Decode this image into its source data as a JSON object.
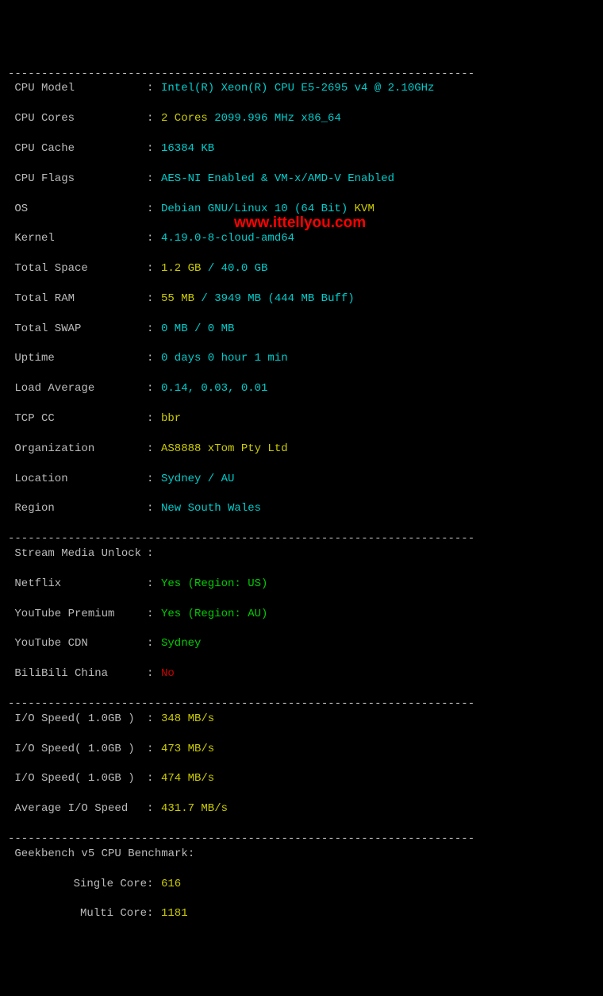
{
  "divider": "----------------------------------------------------------------------",
  "sys": {
    "cpu_model_label": " CPU Model",
    "cpu_model_value": "Intel(R) Xeon(R) CPU E5-2695 v4 @ 2.10GHz",
    "cpu_cores_label": " CPU Cores",
    "cpu_cores_count": "2 Cores",
    "cpu_cores_freq": "2099.996 MHz x86_64",
    "cpu_cache_label": " CPU Cache",
    "cpu_cache_value": "16384 KB",
    "cpu_flags_label": " CPU Flags",
    "cpu_flags_value": "AES-NI Enabled & VM-x/AMD-V Enabled",
    "os_label": " OS",
    "os_name": "Debian GNU/Linux 10 (64 Bit)",
    "os_virt": "KVM",
    "kernel_label": " Kernel",
    "kernel_value": "4.19.0-8-cloud-amd64",
    "total_space_label": " Total Space",
    "total_space_used": "1.2 GB",
    "total_space_sep": " / ",
    "total_space_total": "40.0 GB",
    "total_ram_label": " Total RAM",
    "total_ram_used": "55 MB",
    "total_ram_sep": " / ",
    "total_ram_total": "3949 MB",
    "total_ram_buff": "(444 MB Buff)",
    "total_swap_label": " Total SWAP",
    "total_swap_value": "0 MB / 0 MB",
    "uptime_label": " Uptime",
    "uptime_value": "0 days 0 hour 1 min",
    "load_label": " Load Average",
    "load_value": "0.14, 0.03, 0.01",
    "tcp_cc_label": " TCP CC",
    "tcp_cc_value": "bbr",
    "org_label": " Organization",
    "org_value": "AS8888 xTom Pty Ltd",
    "location_label": " Location",
    "location_value": "Sydney / AU",
    "region_label": " Region",
    "region_value": "New South Wales"
  },
  "stream": {
    "header_label": " Stream Media Unlock",
    "netflix_label": " Netflix",
    "netflix_value": "Yes (Region: US)",
    "yt_premium_label": " YouTube Premium",
    "yt_premium_value": "Yes (Region: AU)",
    "yt_cdn_label": " YouTube CDN",
    "yt_cdn_value": "Sydney",
    "bilibili_label": " BiliBili China",
    "bilibili_value": "No"
  },
  "io": {
    "run1_label": " I/O Speed( 1.0GB )",
    "run1_value": "348 MB/s",
    "run2_label": " I/O Speed( 1.0GB )",
    "run2_value": "473 MB/s",
    "run3_label": " I/O Speed( 1.0GB )",
    "run3_value": "474 MB/s",
    "avg_label": " Average I/O Speed",
    "avg_value": "431.7 MB/s"
  },
  "geekbench": {
    "header": " Geekbench v5 CPU Benchmark:",
    "single_label": "Single Core",
    "single_value": "616",
    "multi_label": "Multi Core",
    "multi_value": "1181"
  },
  "watermark": "www.ittellyou.com",
  "colon": ": "
}
